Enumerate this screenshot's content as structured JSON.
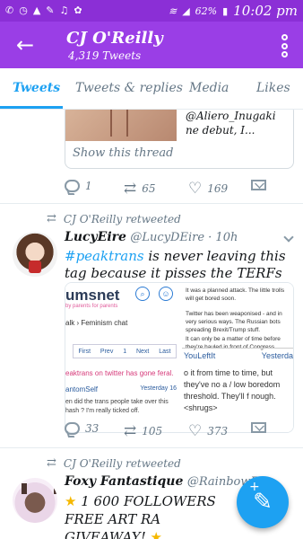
{
  "status_bar": {
    "icons": [
      "whatsapp-icon",
      "clock-icon",
      "warning-icon",
      "wrench-icon",
      "headset-icon",
      "settings-icon",
      "wifi-icon",
      "signal-icon",
      "battery-icon"
    ],
    "battery": "62%",
    "time": "10:02 pm"
  },
  "app_bar": {
    "title": "CJ O'Reilly",
    "subtitle": "4,319 Tweets",
    "color": "#9a3ee6"
  },
  "tabs": [
    {
      "label": "Tweets",
      "active": true
    },
    {
      "label": "Tweets & replies",
      "active": false
    },
    {
      "label": "Media",
      "active": false
    },
    {
      "label": "Likes",
      "active": false
    }
  ],
  "tweet1": {
    "embed_text": "@Aliero_Inugaki ne debut, I...",
    "show_thread": "Show this thread",
    "replies": "1",
    "retweets": "65",
    "likes": "169"
  },
  "tweet2": {
    "retweeted_by": "CJ O'Reilly retweeted",
    "name": "LucyEire",
    "handle": "@LucyDEire · 10h",
    "hashtag": "#peaktrans",
    "text": " is never leaving this tag because it pisses the TERFs off.",
    "media": {
      "left": {
        "brand": "umsnet",
        "brand_sub": "by parents for parents",
        "breadcrumb": "alk › Feminism chat",
        "pager": [
          "First",
          "Prev",
          "1",
          "Next",
          "Last"
        ],
        "thread_title": "eaktrans on twitter has gone feral.",
        "author": "antomSelf",
        "when": "Yesterday 16",
        "quote": "en did the trans people take over this hash ? I'm really ticked off."
      },
      "right": {
        "line1": "It was a planned attack. The little trolls will get bored soon.",
        "line2": "Twitter has been weaponised - and in very serious ways. The Russian bots spreading Brexit/Trump stuff.",
        "line3": "It can only be a matter of time before they're hauled in front of Congress.",
        "author": "YouLeftIt",
        "when": "Yesterda",
        "quote": "o it from time to time, but they've no a / low boredom threshold. They'll f nough. <shrugs>"
      }
    },
    "replies": "33",
    "retweets": "105",
    "likes": "373"
  },
  "tweet3": {
    "retweeted_by": "CJ O'Reilly retweeted",
    "name": "Foxy Fantastique",
    "handle": "@RainbowFo...",
    "text": "1 600 FOLLOWERS FREE ART RA GIVEAWAY!"
  },
  "fab": {
    "icon": "compose-tweet-icon"
  }
}
